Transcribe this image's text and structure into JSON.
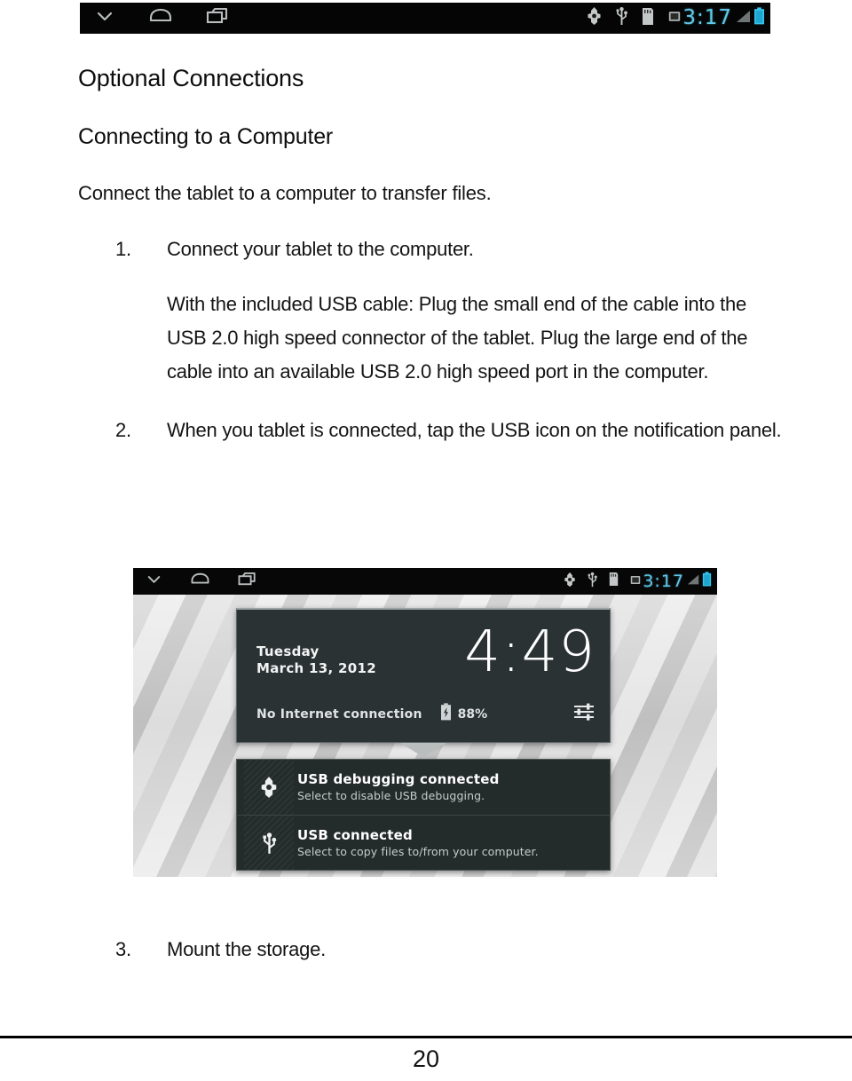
{
  "status_bar": {
    "nav": [
      {
        "icon": "back-chevron-down-icon"
      },
      {
        "icon": "home-icon"
      },
      {
        "icon": "recent-apps-icon"
      }
    ],
    "system_icons": [
      {
        "icon": "android-debug-icon"
      },
      {
        "icon": "usb-icon"
      },
      {
        "icon": "sd-card-icon"
      },
      {
        "icon": "screenshot-icon"
      }
    ],
    "clock": "3:17",
    "signal_icon": "signal-bars-icon",
    "battery_icon": "battery-icon",
    "accent_color": "#5fc8e8",
    "background_color": "#050505"
  },
  "document": {
    "heading1": "Optional Connections",
    "heading2": "Connecting to a Computer",
    "intro": "Connect the tablet to a computer to transfer files.",
    "steps": [
      {
        "number": "1.",
        "text": "Connect your tablet to the computer.",
        "detail": "With the included USB cable: Plug the small end of the cable into the USB 2.0 high speed connector of the tablet. Plug the large end of the cable into an available USB 2.0 high speed port in the computer."
      },
      {
        "number": "2.",
        "text": "When you tablet is connected, tap the USB icon on the notification panel.",
        "detail": ""
      },
      {
        "number": "3.",
        "text": "Mount the storage.",
        "detail": ""
      }
    ]
  },
  "screenshot": {
    "status_bar": {
      "clock": "3:17"
    },
    "notification_shade": {
      "day": "Tuesday",
      "date": "March 13, 2012",
      "time": "4:49",
      "network_status": "No Internet connection",
      "battery_percent": "88%",
      "battery_icon": "battery-charging-icon",
      "settings_icon": "settings-sliders-icon",
      "notifications": [
        {
          "icon": "android-debug-icon",
          "title": "USB debugging connected",
          "subtitle": "Select to disable USB debugging."
        },
        {
          "icon": "usb-icon",
          "title": "USB connected",
          "subtitle": "Select to copy files to/from your computer."
        }
      ]
    }
  },
  "footer": {
    "page_number": "20"
  }
}
